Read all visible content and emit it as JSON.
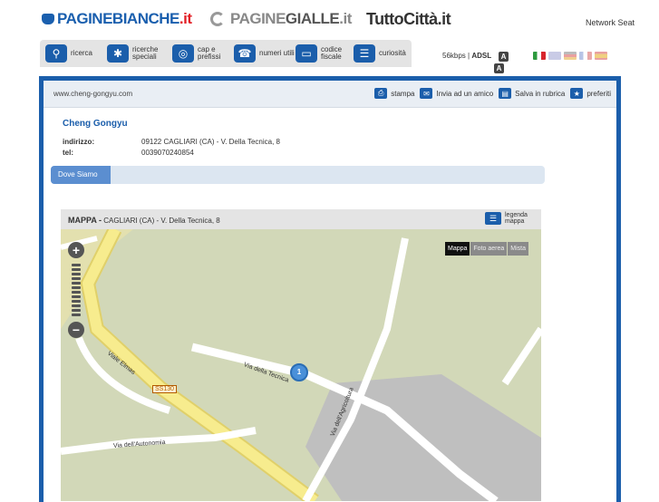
{
  "brands": {
    "paginebianche": {
      "prefix": "PAGINE",
      "strong": "BIANCHE",
      "suffix": ".it"
    },
    "paginegialle": {
      "prefix": "PAGINE",
      "strong": "GIALLE",
      "suffix": ".it"
    },
    "tuttocitta": {
      "prefix": "TuttoCittà",
      "suffix": ".it"
    }
  },
  "network_link": "Network Seat",
  "nav": {
    "items": [
      {
        "label": "ricerca",
        "icon": "search-icon"
      },
      {
        "label": "ricerche speciali",
        "icon": "puzzle-icon"
      },
      {
        "label": "cap e prefissi",
        "icon": "globe-icon"
      },
      {
        "label": "numeri utili",
        "icon": "phone-icon"
      },
      {
        "label": "codice fiscale",
        "icon": "card-icon"
      },
      {
        "label": "curiosità",
        "icon": "book-icon"
      }
    ]
  },
  "connection": {
    "speed": "56kbps",
    "separator": "|",
    "adsl": "ADSL",
    "a1": "A",
    "a2": "A"
  },
  "flags": [
    {
      "name": "italian-flag-icon",
      "color": "#2e9a3f"
    },
    {
      "name": "english-flag-icon",
      "color": "#c9cbe6"
    },
    {
      "name": "german-flag-icon",
      "color": "#e9c3a0"
    },
    {
      "name": "french-flag-icon",
      "color": "#d9c7c7"
    },
    {
      "name": "spanish-flag-icon",
      "color": "#f0c27a"
    }
  ],
  "colors": {
    "accent": "#1b5eab",
    "tab": "#5b8ed0",
    "map_bg": "#d2d8b8"
  },
  "detail": {
    "url": "www.cheng-gongyu.com",
    "tools": {
      "print": "stampa",
      "send": "Invia ad un amico",
      "save": "Salva in rubrica",
      "favorites": "preferiti"
    },
    "name": "Cheng Gongyu",
    "address_label": "indirizzo:",
    "address_value": "09122 CAGLIARI (CA) - V. Della Tecnica, 8",
    "phone_label": "tel:",
    "phone_value": "0039070240854"
  },
  "tabs": {
    "dove_siamo": "Dove Siamo"
  },
  "map": {
    "title": "MAPPA -",
    "subtitle": "CAGLIARI (CA) - V. Della Tecnica, 8",
    "legend": "legenda mappa",
    "types": {
      "map": "Mappa",
      "satellite": "Foto aerea",
      "hybrid": "Mista"
    },
    "marker": "1",
    "roads": {
      "viale_elmas": "Viale Elmas",
      "via_tecnica": "Via della Tecnica",
      "via_agricoltura": "Via dell'Agricoltura",
      "via_autonomia": "Via dell'Autonomia",
      "ss130": "SS130"
    },
    "zoom_in": "+",
    "zoom_out": "−"
  }
}
